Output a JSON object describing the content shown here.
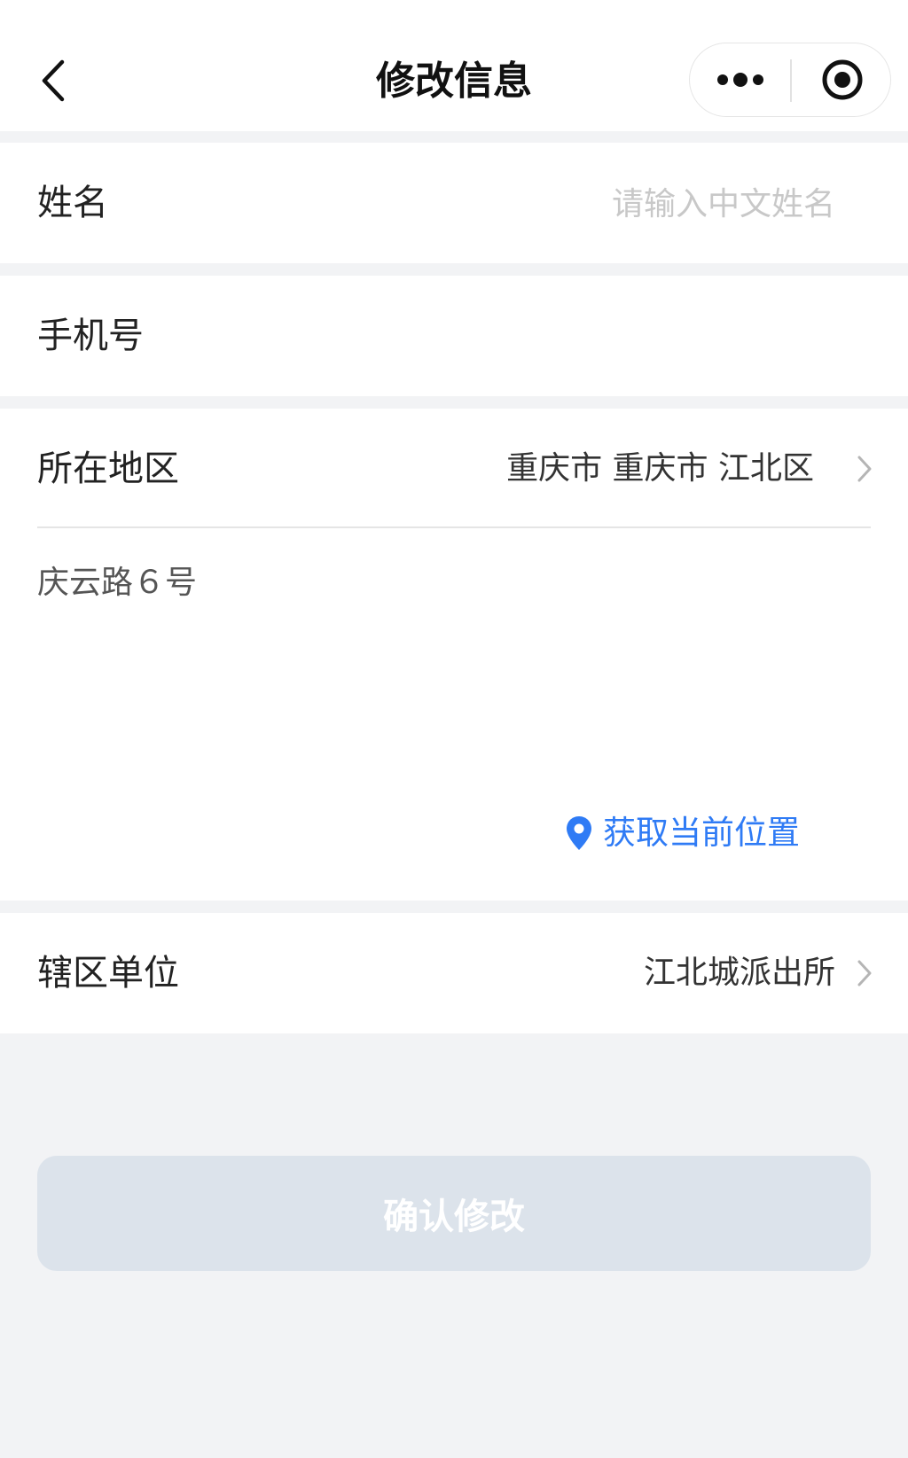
{
  "header": {
    "title": "修改信息",
    "back_icon": "chevron-left-icon",
    "more_icon": "more-dots-icon",
    "close_icon": "target-circle-icon"
  },
  "form": {
    "name": {
      "label": "姓名",
      "value": "",
      "placeholder": "请输入中文姓名"
    },
    "phone": {
      "label": "手机号",
      "value": ""
    },
    "region": {
      "label": "所在地区",
      "value": "重庆市 重庆市 江北区"
    },
    "address": {
      "value": "庆云路６号"
    },
    "locate": {
      "label": "获取当前位置",
      "icon": "location-pin-icon"
    },
    "unit": {
      "label": "辖区单位",
      "value": "江北城派出所"
    }
  },
  "submit": {
    "label": "确认修改"
  },
  "colors": {
    "accent": "#2f7bf5",
    "page_bg": "#f2f3f5",
    "card_bg": "#ffffff",
    "button_disabled": "#dce3eb",
    "placeholder": "#c8c8c8"
  }
}
